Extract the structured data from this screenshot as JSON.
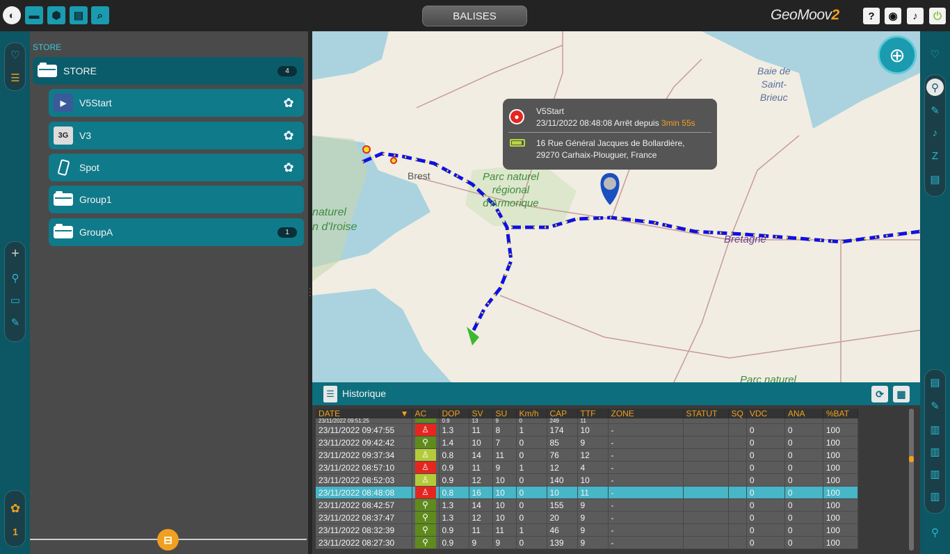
{
  "app": {
    "title": "BALISES",
    "brand": "GeoMoov",
    "brand_version": "2"
  },
  "topbar": {
    "left_icons": [
      "globe-icon",
      "truck-icon",
      "shape-icon",
      "document-icon",
      "search-icon"
    ],
    "right_icons": [
      "help-icon",
      "palette-icon",
      "bell-icon",
      "power-icon"
    ]
  },
  "tree": {
    "header": "STORE",
    "root": {
      "label": "STORE",
      "count": "4"
    },
    "items": [
      {
        "label": "V5Start",
        "icon": "v5-device-icon",
        "trailing": "paw-icon"
      },
      {
        "label": "V3",
        "icon": "3g-device-icon",
        "thumb_text": "3G",
        "trailing": "paw-icon"
      },
      {
        "label": "Spot",
        "icon": "phone-icon",
        "trailing": "paw-icon"
      },
      {
        "label": "Group1",
        "icon": "folder-icon"
      },
      {
        "label": "GroupA",
        "icon": "folder-icon",
        "count": "1"
      }
    ]
  },
  "left_rail": {
    "bottom_count": "1"
  },
  "map": {
    "labels": {
      "bay": "Baie de\nSaint-\nBrieuc",
      "brest": "Brest",
      "park": "Parc naturel\nrégional\nd'Armorique",
      "iroise": "naturel\nn d'Iroise",
      "bretagne": "Bretagne",
      "parc_bottom": "Parc naturel"
    },
    "popup": {
      "device": "V5Start",
      "datetime": "23/11/2022 08:48:08 Arrêt depuis",
      "duration": "3min 55s",
      "address_line1": "16 Rue Général Jacques de Bollardière,",
      "address_line2": "29270 Carhaix-Plouguer, France"
    },
    "route_color": "#1010e0",
    "route_dot_color": "#f0e020",
    "end_marker_color": "#3cb82e"
  },
  "history": {
    "title": "Historique",
    "columns": [
      "DATE",
      "AC",
      "DOP",
      "SV",
      "SU",
      "Km/h",
      "CAP",
      "TTF",
      "ZONE",
      "STATUT",
      "SQ",
      "VDC",
      "ANA",
      "%BAT"
    ],
    "partial_row": {
      "date": "23/11/2022 09:51:25",
      "dop": "0.9",
      "sv": "13",
      "su": "9",
      "kmh": "0",
      "cap": "249",
      "ttf": "11"
    },
    "rows": [
      {
        "date": "23/11/2022 09:47:55",
        "ac": "stop",
        "dop": "1.3",
        "sv": "11",
        "su": "8",
        "kmh": "1",
        "cap": "174",
        "ttf": "10",
        "zone": "-",
        "statut": "",
        "sq": "",
        "vdc": "0",
        "ana": "0",
        "bat": "100"
      },
      {
        "date": "23/11/2022 09:42:42",
        "ac": "walk",
        "dop": "1.4",
        "sv": "10",
        "su": "7",
        "kmh": "0",
        "cap": "85",
        "ttf": "9",
        "zone": "-",
        "statut": "",
        "sq": "",
        "vdc": "0",
        "ana": "0",
        "bat": "100"
      },
      {
        "date": "23/11/2022 09:37:34",
        "ac": "idle",
        "dop": "0.8",
        "sv": "14",
        "su": "11",
        "kmh": "0",
        "cap": "76",
        "ttf": "12",
        "zone": "-",
        "statut": "",
        "sq": "",
        "vdc": "0",
        "ana": "0",
        "bat": "100"
      },
      {
        "date": "23/11/2022 08:57:10",
        "ac": "stop",
        "dop": "0.9",
        "sv": "11",
        "su": "9",
        "kmh": "1",
        "cap": "12",
        "ttf": "4",
        "zone": "-",
        "statut": "",
        "sq": "",
        "vdc": "0",
        "ana": "0",
        "bat": "100"
      },
      {
        "date": "23/11/2022 08:52:03",
        "ac": "idle",
        "dop": "0.9",
        "sv": "12",
        "su": "10",
        "kmh": "0",
        "cap": "140",
        "ttf": "10",
        "zone": "-",
        "statut": "",
        "sq": "",
        "vdc": "0",
        "ana": "0",
        "bat": "100"
      },
      {
        "date": "23/11/2022 08:48:08",
        "ac": "stop",
        "dop": "0.8",
        "sv": "16",
        "su": "10",
        "kmh": "0",
        "cap": "10",
        "ttf": "11",
        "zone": "-",
        "statut": "",
        "sq": "",
        "vdc": "0",
        "ana": "0",
        "bat": "100",
        "selected": true
      },
      {
        "date": "23/11/2022 08:42:57",
        "ac": "walk",
        "dop": "1.3",
        "sv": "14",
        "su": "10",
        "kmh": "0",
        "cap": "155",
        "ttf": "9",
        "zone": "-",
        "statut": "",
        "sq": "",
        "vdc": "0",
        "ana": "0",
        "bat": "100"
      },
      {
        "date": "23/11/2022 08:37:47",
        "ac": "walk",
        "dop": "1.3",
        "sv": "12",
        "su": "10",
        "kmh": "0",
        "cap": "20",
        "ttf": "9",
        "zone": "-",
        "statut": "",
        "sq": "",
        "vdc": "0",
        "ana": "0",
        "bat": "100"
      },
      {
        "date": "23/11/2022 08:32:39",
        "ac": "walk",
        "dop": "0.9",
        "sv": "11",
        "su": "11",
        "kmh": "1",
        "cap": "46",
        "ttf": "9",
        "zone": "-",
        "statut": "",
        "sq": "",
        "vdc": "0",
        "ana": "0",
        "bat": "100"
      },
      {
        "date": "23/11/2022 08:27:30",
        "ac": "walk",
        "dop": "0.9",
        "sv": "9",
        "su": "9",
        "kmh": "0",
        "cap": "139",
        "ttf": "9",
        "zone": "-",
        "statut": "",
        "sq": "",
        "vdc": "0",
        "ana": "0",
        "bat": "100"
      }
    ]
  },
  "colors": {
    "accent": "#1a9bb0",
    "orange": "#f0a020",
    "stop": "#e52620",
    "walk": "#5f8a1d",
    "idle": "#b3cb3a",
    "selected_row": "#47b6c7"
  }
}
